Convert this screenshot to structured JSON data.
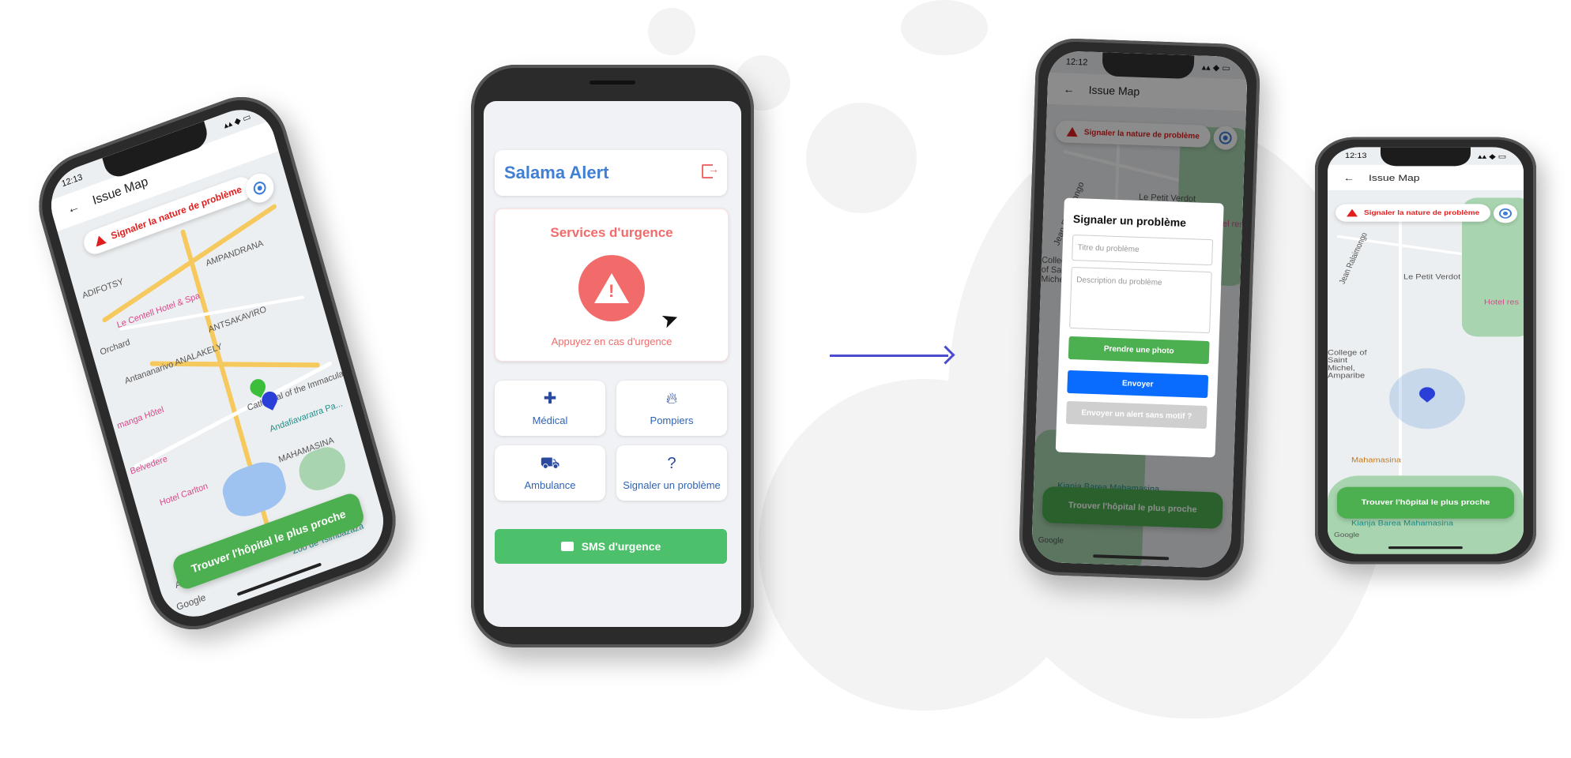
{
  "map_phone_left": {
    "status_time": "12:13",
    "appbar_title": "Issue Map",
    "alert_chip": "Signaler la nature de problème",
    "find_hospital_button": "Trouver l'hôpital le plus proche",
    "google": "Google",
    "labels": {
      "adifotsy": "ADIFOTSY",
      "ampandrana": "AMPANDRANA",
      "centell": "Le Centell Hotel & Spa",
      "orchard": "Orchard",
      "antsakaviro": "ANTSAKAVIRO",
      "analakely": "Antananarivo  ANALAKELY",
      "hotel_manga": "manga Hôtel",
      "belvedere": "Belvedere",
      "cathedral": "Cathedral of the Immaculate...",
      "andafiavaratra": "Andafiavaratra Pa...",
      "hotel_carlton": "Hotel Carlton",
      "mahamasina": "MAHAMASINA",
      "andavamamba": "ANDAVAMAMBA",
      "zoo": "Zoo de Tsimbazaza"
    }
  },
  "main_app": {
    "app_title": "Salama Alert",
    "emergency_title": "Services d'urgence",
    "emergency_hint": "Appuyez en cas d'urgence",
    "tiles": [
      {
        "label": "Médical",
        "icon": "medical-kit-icon"
      },
      {
        "label": "Pompiers",
        "icon": "fire-icon"
      },
      {
        "label": "Ambulance",
        "icon": "ambulance-icon"
      },
      {
        "label": "Signaler un problème",
        "icon": "question-icon"
      }
    ],
    "sms_button": "SMS d'urgence",
    "colors": {
      "primary": "#3f7fd4",
      "danger": "#f26b6b",
      "success": "#4cc06a"
    }
  },
  "modal_phone": {
    "status_time": "12:12",
    "appbar_title": "Issue Map",
    "alert_chip": "Signaler la nature de problème",
    "modal_title": "Signaler un problème",
    "title_placeholder": "Titre du problème",
    "description_placeholder": "Description du problème",
    "photo_button": "Prendre une photo",
    "send_button": "Envoyer",
    "send_no_reason_button": "Envoyer un alert sans motif ?",
    "find_hospital_button": "Trouver l'hôpital le plus proche",
    "labels": {
      "jean": "Jean Ralaimongo",
      "petit_verdot": "Le Petit Verdot",
      "hotel_res": "Hotel res",
      "college": "College of Saint Michel",
      "kianja": "Kianja Barea Mahamasina"
    },
    "google": "Google"
  },
  "map_phone_right": {
    "status_time": "12:13",
    "appbar_title": "Issue Map",
    "alert_chip": "Signaler la nature de problème",
    "find_hospital_button": "Trouver l'hôpital le plus proche",
    "labels": {
      "jean": "Jean Ralaimongo",
      "petit_verdot": "Le Petit Verdot",
      "hotel_res": "Hotel res",
      "college": "College of Saint Michel, Amparibe",
      "mahamasina": "Mahamasina",
      "kianja": "Kianja Barea Mahamasina"
    },
    "google": "Google"
  }
}
